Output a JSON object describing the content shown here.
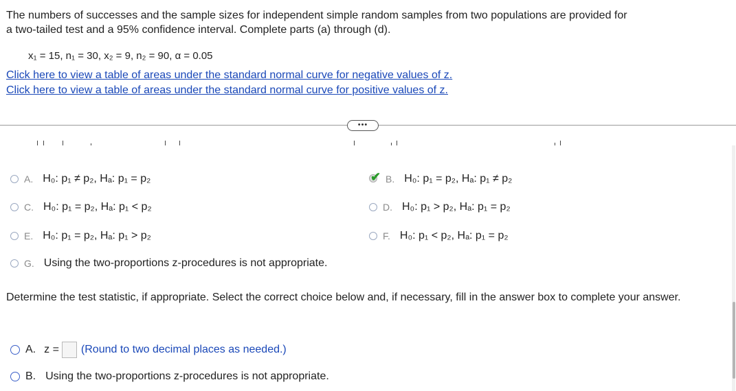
{
  "intro": {
    "line1": "The numbers of successes and the sample sizes for independent simple random samples from two populations are provided for",
    "line2": "a two-tailed test and a 95% confidence interval. Complete parts (a) through (d)."
  },
  "params": "x₁ = 15, n₁ = 30, x₂ = 9, n₂ = 90, α = 0.05",
  "links": {
    "negative": "Click here to view a table of areas under the standard normal curve for negative values of z.",
    "positive": "Click here to view a table of areas under the standard normal curve for positive values of z."
  },
  "more_button": "•••",
  "hypotheses": {
    "A": {
      "letter": "A.",
      "text": "H₀: p₁ ≠ p₂, Hₐ: p₁ = p₂"
    },
    "B": {
      "letter": "B.",
      "text": "H₀: p₁ = p₂, Hₐ: p₁ ≠ p₂",
      "selected": true
    },
    "C": {
      "letter": "C.",
      "text": "H₀: p₁ = p₂, Hₐ: p₁ < p₂"
    },
    "D": {
      "letter": "D.",
      "text": "H₀: p₁ > p₂, Hₐ: p₁ = p₂"
    },
    "E": {
      "letter": "E.",
      "text": "H₀: p₁ = p₂, Hₐ: p₁ > p₂"
    },
    "F": {
      "letter": "F.",
      "text": "H₀: p₁ < p₂, Hₐ: p₁ = p₂"
    },
    "G": {
      "letter": "G.",
      "text": "Using the two-proportions z-procedures is not appropriate."
    }
  },
  "prompt": "Determine the test statistic, if appropriate. Select the correct choice below and, if necessary, fill in the answer box to complete your answer.",
  "stat_choices": {
    "A": {
      "letter": "A.",
      "prefix": "z =",
      "note": "(Round to two decimal places as needed.)",
      "value": ""
    },
    "B": {
      "letter": "B.",
      "text": "Using the two-proportions z-procedures is not appropriate."
    }
  },
  "colors": {
    "link": "#1a48b8",
    "check": "#2a9a2a"
  }
}
